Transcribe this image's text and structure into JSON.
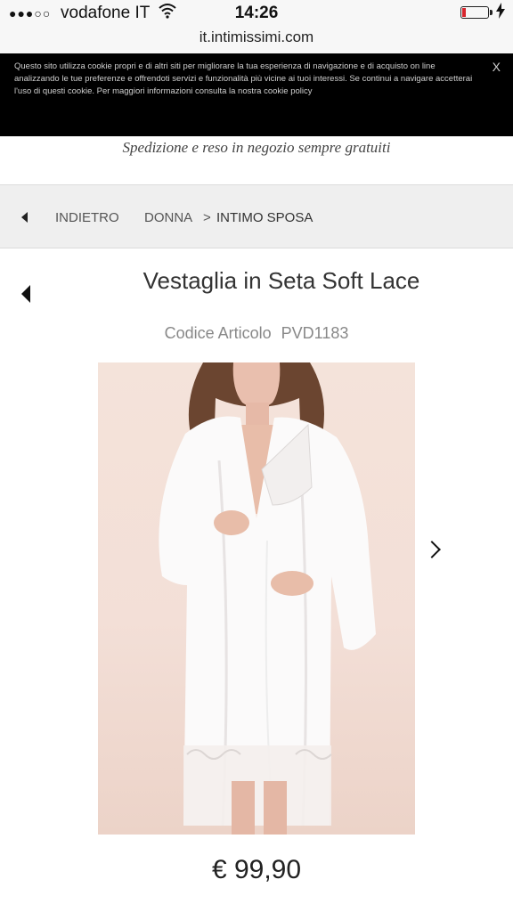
{
  "status_bar": {
    "signal": "●●●○○",
    "carrier": "vodafone IT",
    "wifi_icon": "wifi-icon",
    "time": "14:26",
    "battery_level": 0.15,
    "battery_color": "#d7262e",
    "charging_icon": "lightning-icon"
  },
  "browser": {
    "url": "it.intimissimi.com"
  },
  "cookie_banner": {
    "text": "Questo sito utilizza cookie propri e di altri siti per migliorare la tua esperienza di navigazione e di acquisto on line analizzando le tue preferenze e offrendoti servizi e funzionalità più vicine ai tuoi interessi. Se continui a navigare accetterai l'uso di questi cookie. Per maggiori informazioni consulta la nostra cookie policy",
    "close_label": "X"
  },
  "promo": {
    "text": "Spedizione e reso in negozio sempre gratuiti"
  },
  "breadcrumb": {
    "back_label": "INDIETRO",
    "level1": "DONNA",
    "separator": ">",
    "level2": "INTIMO SPOSA"
  },
  "product": {
    "title": "Vestaglia in Seta Soft Lace",
    "code_label": "Codice Articolo",
    "code_value": "PVD1183",
    "price": "€ 99,90"
  }
}
